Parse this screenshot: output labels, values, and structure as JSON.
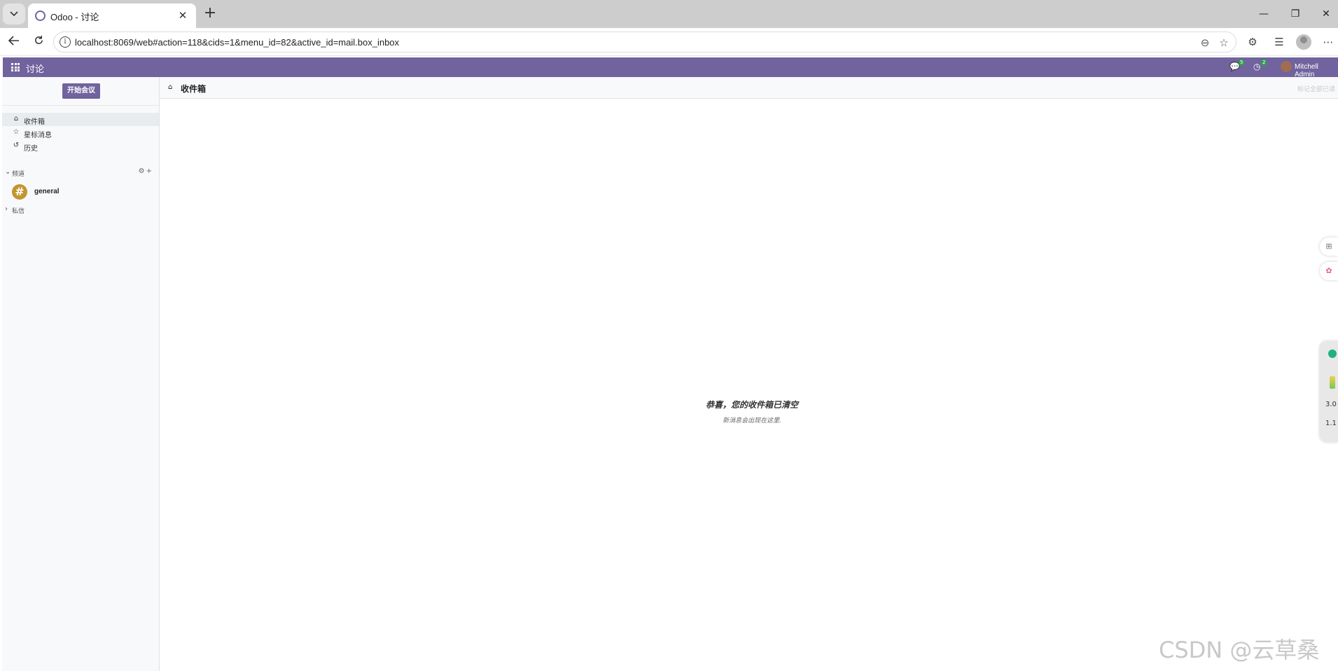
{
  "browser": {
    "tab_title": "Odoo - 讨论",
    "url": "localhost:8069/web#action=118&cids=1&menu_id=82&active_id=mail.box_inbox"
  },
  "navbar": {
    "app_name": "讨论",
    "messages_badge": "5",
    "activities_badge": "2",
    "user_name": "Mitchell Admin",
    "brand_color": "#71639e"
  },
  "sidebar": {
    "start_meeting": "开始会议",
    "mailboxes": [
      {
        "label": "收件箱",
        "icon": "inbox-icon",
        "active": true
      },
      {
        "label": "星标消息",
        "icon": "star-icon",
        "active": false
      },
      {
        "label": "历史",
        "icon": "history-icon",
        "active": false
      }
    ],
    "channels_label": "频道",
    "channels": [
      {
        "name": "general",
        "avatar_glyph": "#"
      }
    ],
    "direct_messages_label": "私信"
  },
  "main": {
    "title": "收件箱",
    "mark_all_read": "标记全部已读",
    "empty_title": "恭喜，您的收件箱已清空",
    "empty_subtitle": "新消息会出现在这里."
  },
  "float_panel": {
    "line1": "3.0",
    "line2": "1.1"
  },
  "watermark": "CSDN @云草桑"
}
